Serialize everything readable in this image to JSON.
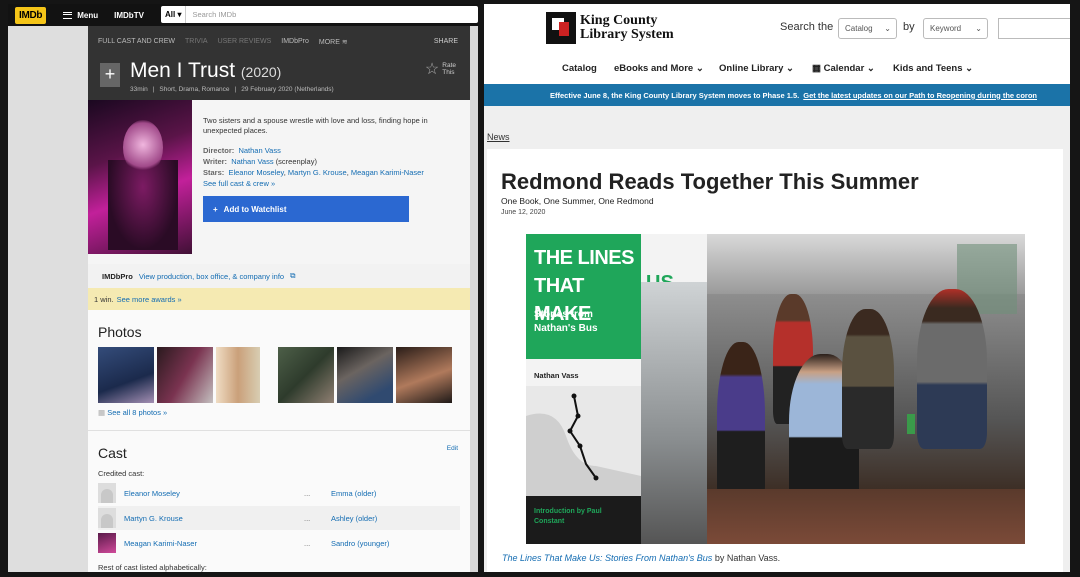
{
  "imdb": {
    "logo": "IMDb",
    "menu_label": "Menu",
    "tv_logo": "IMDbTV",
    "search_category": "All",
    "search_placeholder": "Search IMDb",
    "subnav": [
      "FULL CAST AND CREW",
      "TRIVIA",
      "USER REVIEWS",
      "IMDbPro",
      "MORE"
    ],
    "share": "SHARE",
    "title": "Men I Trust",
    "year": "(2020)",
    "runtime": "33min",
    "genres": "Short, Drama, Romance",
    "release": "29 February 2020 (Netherlands)",
    "rate_label_1": "Rate",
    "rate_label_2": "This",
    "description": "Two sisters and a spouse wrestle with love and loss, finding hope in unexpected places.",
    "director_label": "Director:",
    "director": "Nathan Vass",
    "writer_label": "Writer:",
    "writer": "Nathan Vass",
    "writer_note": "(screenplay)",
    "stars_label": "Stars:",
    "stars": [
      "Eleanor Moseley",
      "Martyn G. Krouse",
      "Meagan Karimi-Naser"
    ],
    "see_full_cast": "See full cast & crew »",
    "watchlist": "Add to Watchlist",
    "pro_logo": "IMDbPro",
    "pro_link": "View production, box office, & company info",
    "awards_text": "1 win.",
    "awards_link": "See more awards »",
    "photos_heading": "Photos",
    "see_all_photos": "See all 8 photos »",
    "cast_heading": "Cast",
    "edit": "Edit",
    "credited_cast": "Credited cast:",
    "cast": [
      {
        "name": "Eleanor Moseley",
        "character": "Emma (older)"
      },
      {
        "name": "Martyn G. Krouse",
        "character": "Ashley (older)"
      },
      {
        "name": "Meagan Karimi-Naser",
        "character": "Sandro (younger)"
      }
    ],
    "rest_of_cast": "Rest of cast listed alphabetically:"
  },
  "kcls": {
    "logo_line1": "King County",
    "logo_line2": "Library System",
    "search_the": "Search the",
    "catalog_select": "Catalog",
    "by": "by",
    "keyword_select": "Keyword",
    "nav": [
      "Catalog",
      "eBooks and More",
      "Online Library",
      "Calendar",
      "Kids and Teens"
    ],
    "banner_text": "Effective June 8, the King County Library System moves to Phase 1.5.",
    "banner_link": "Get the latest updates on our Path to Reopening during the coron",
    "section": "News",
    "headline": "Redmond Reads Together This Summer",
    "subhead": "One Book, One Summer, One Redmond",
    "date": "June 12, 2020",
    "book_title_a": "THE LINES",
    "book_title_b": "THAT MAKE",
    "book_title_c": "US",
    "book_subtitle": "Stories from Nathan's Bus",
    "book_author": "Nathan Vass",
    "book_intro": "Introduction by Paul Constant",
    "caption_title": "The Lines That Make Us: Stories From Nathan's Bus",
    "caption_rest": " by Nathan Vass."
  }
}
